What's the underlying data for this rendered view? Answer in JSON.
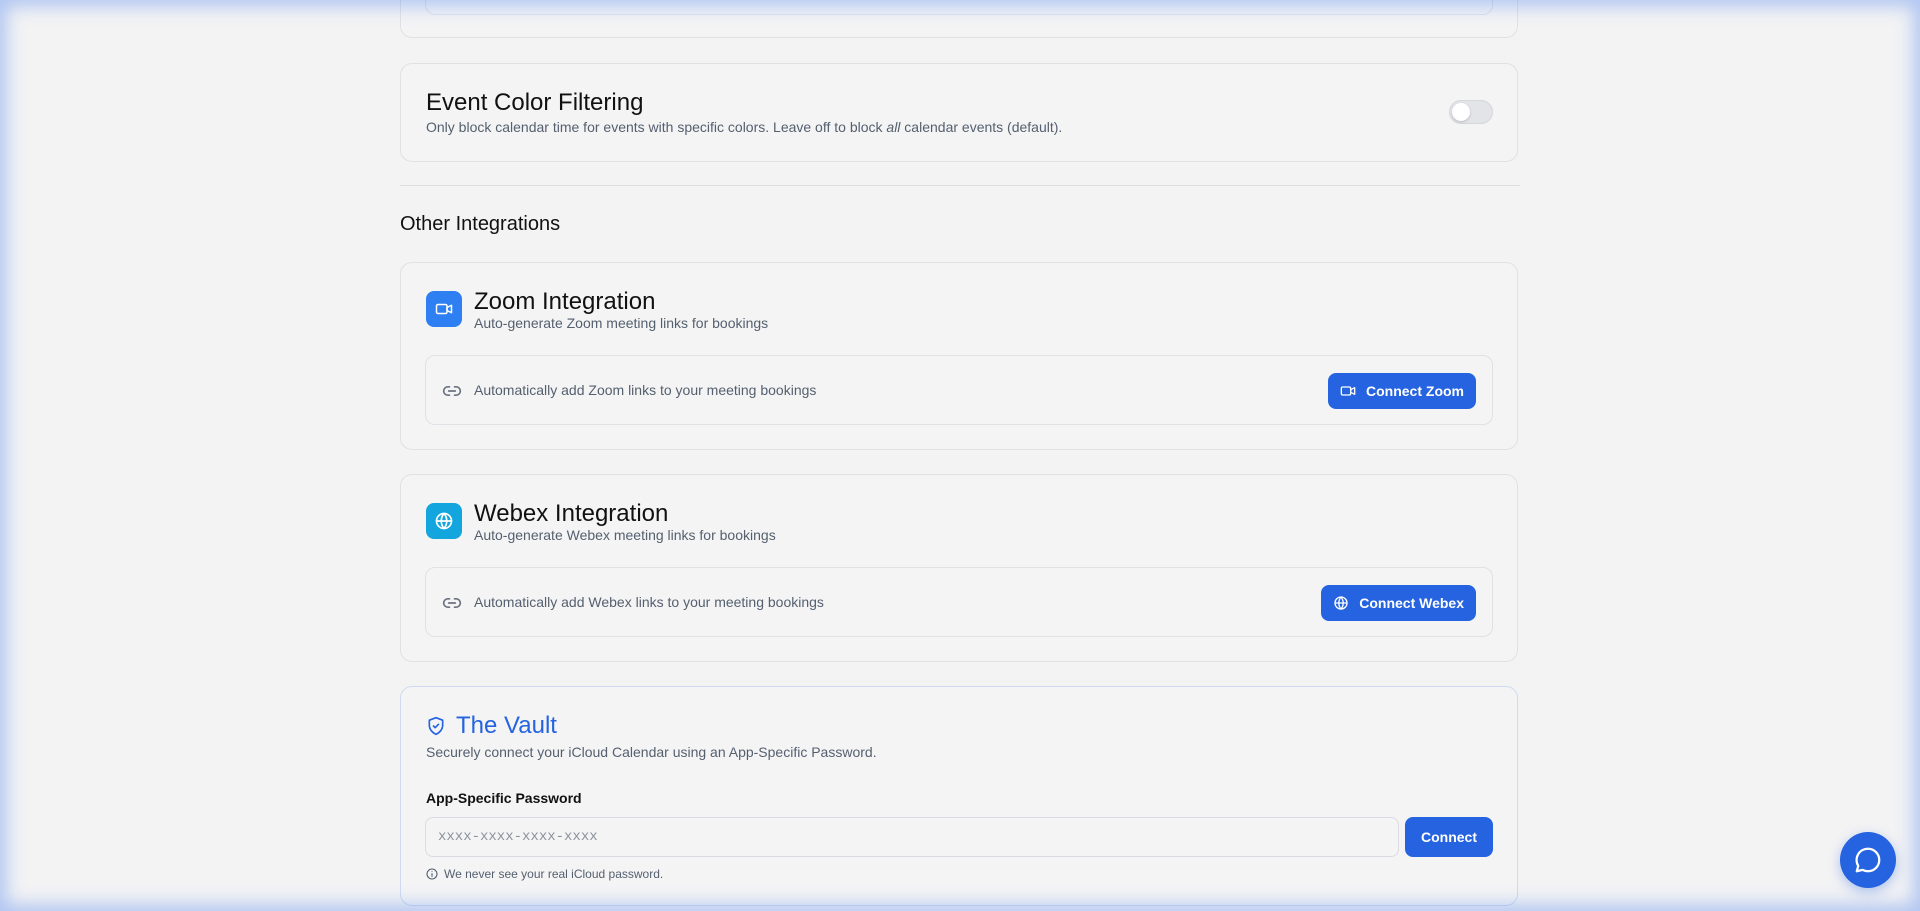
{
  "event_color_filtering": {
    "title": "Event Color Filtering",
    "description_before": "Only block calendar time for events with specific colors. Leave off to block ",
    "description_emphasis": "all",
    "description_after": " calendar events (default).",
    "toggle_state": "off"
  },
  "other_integrations": {
    "heading": "Other Integrations",
    "zoom": {
      "icon": "video-camera-icon",
      "title": "Zoom Integration",
      "subtitle": "Auto-generate Zoom meeting links for bookings",
      "row_text": "Automatically add Zoom links to your meeting bookings",
      "button_label": "Connect Zoom"
    },
    "webex": {
      "icon": "globe-icon",
      "title": "Webex Integration",
      "subtitle": "Auto-generate Webex meeting links for bookings",
      "row_text": "Automatically add Webex links to your meeting bookings",
      "button_label": "Connect Webex"
    }
  },
  "vault": {
    "icon": "shield-check-icon",
    "title": "The Vault",
    "description": "Securely connect your iCloud Calendar using an App-Specific Password.",
    "field_label": "App-Specific Password",
    "input_placeholder": "xxxx-xxxx-xxxx-xxxx",
    "input_value": "",
    "connect_label": "Connect",
    "hint": "We never see your real iCloud password."
  },
  "colors": {
    "primary": "#2563e0",
    "zoom_icon_bg": "#2d7ff2",
    "webex_icon_bg": "#13a5dd"
  }
}
